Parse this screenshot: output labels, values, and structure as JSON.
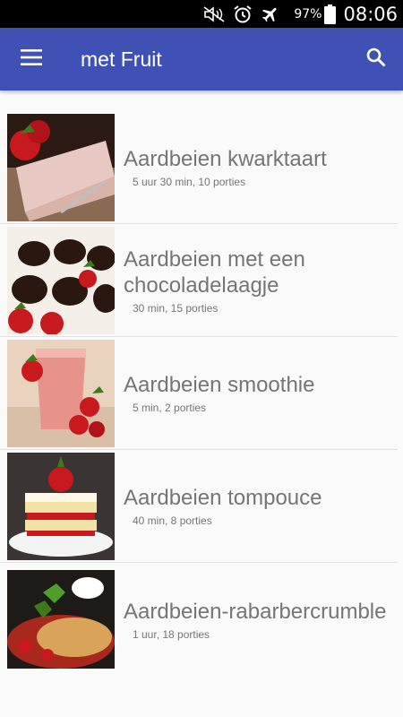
{
  "status_bar": {
    "icons": [
      "mute-icon",
      "alarm-icon",
      "airplane-mode-icon",
      "battery-icon"
    ],
    "battery": "97%",
    "time": "08:06"
  },
  "app_bar": {
    "title": "met Fruit",
    "menu_icon": "hamburger-menu-icon",
    "search_icon": "search-icon",
    "color": "#3f51b5"
  },
  "recipes": [
    {
      "title": "Aardbeien kwarktaart",
      "meta": "5 uur 30 min, 10 porties"
    },
    {
      "title": "Aardbeien met een chocoladelaagje",
      "meta": "30 min, 15 porties"
    },
    {
      "title": "Aardbeien smoothie",
      "meta": "5 min, 2 porties"
    },
    {
      "title": "Aardbeien tompouce",
      "meta": "40 min, 8 porties"
    },
    {
      "title": "Aardbeien-rabarbercrumble",
      "meta": "1 uur, 18 porties"
    }
  ]
}
